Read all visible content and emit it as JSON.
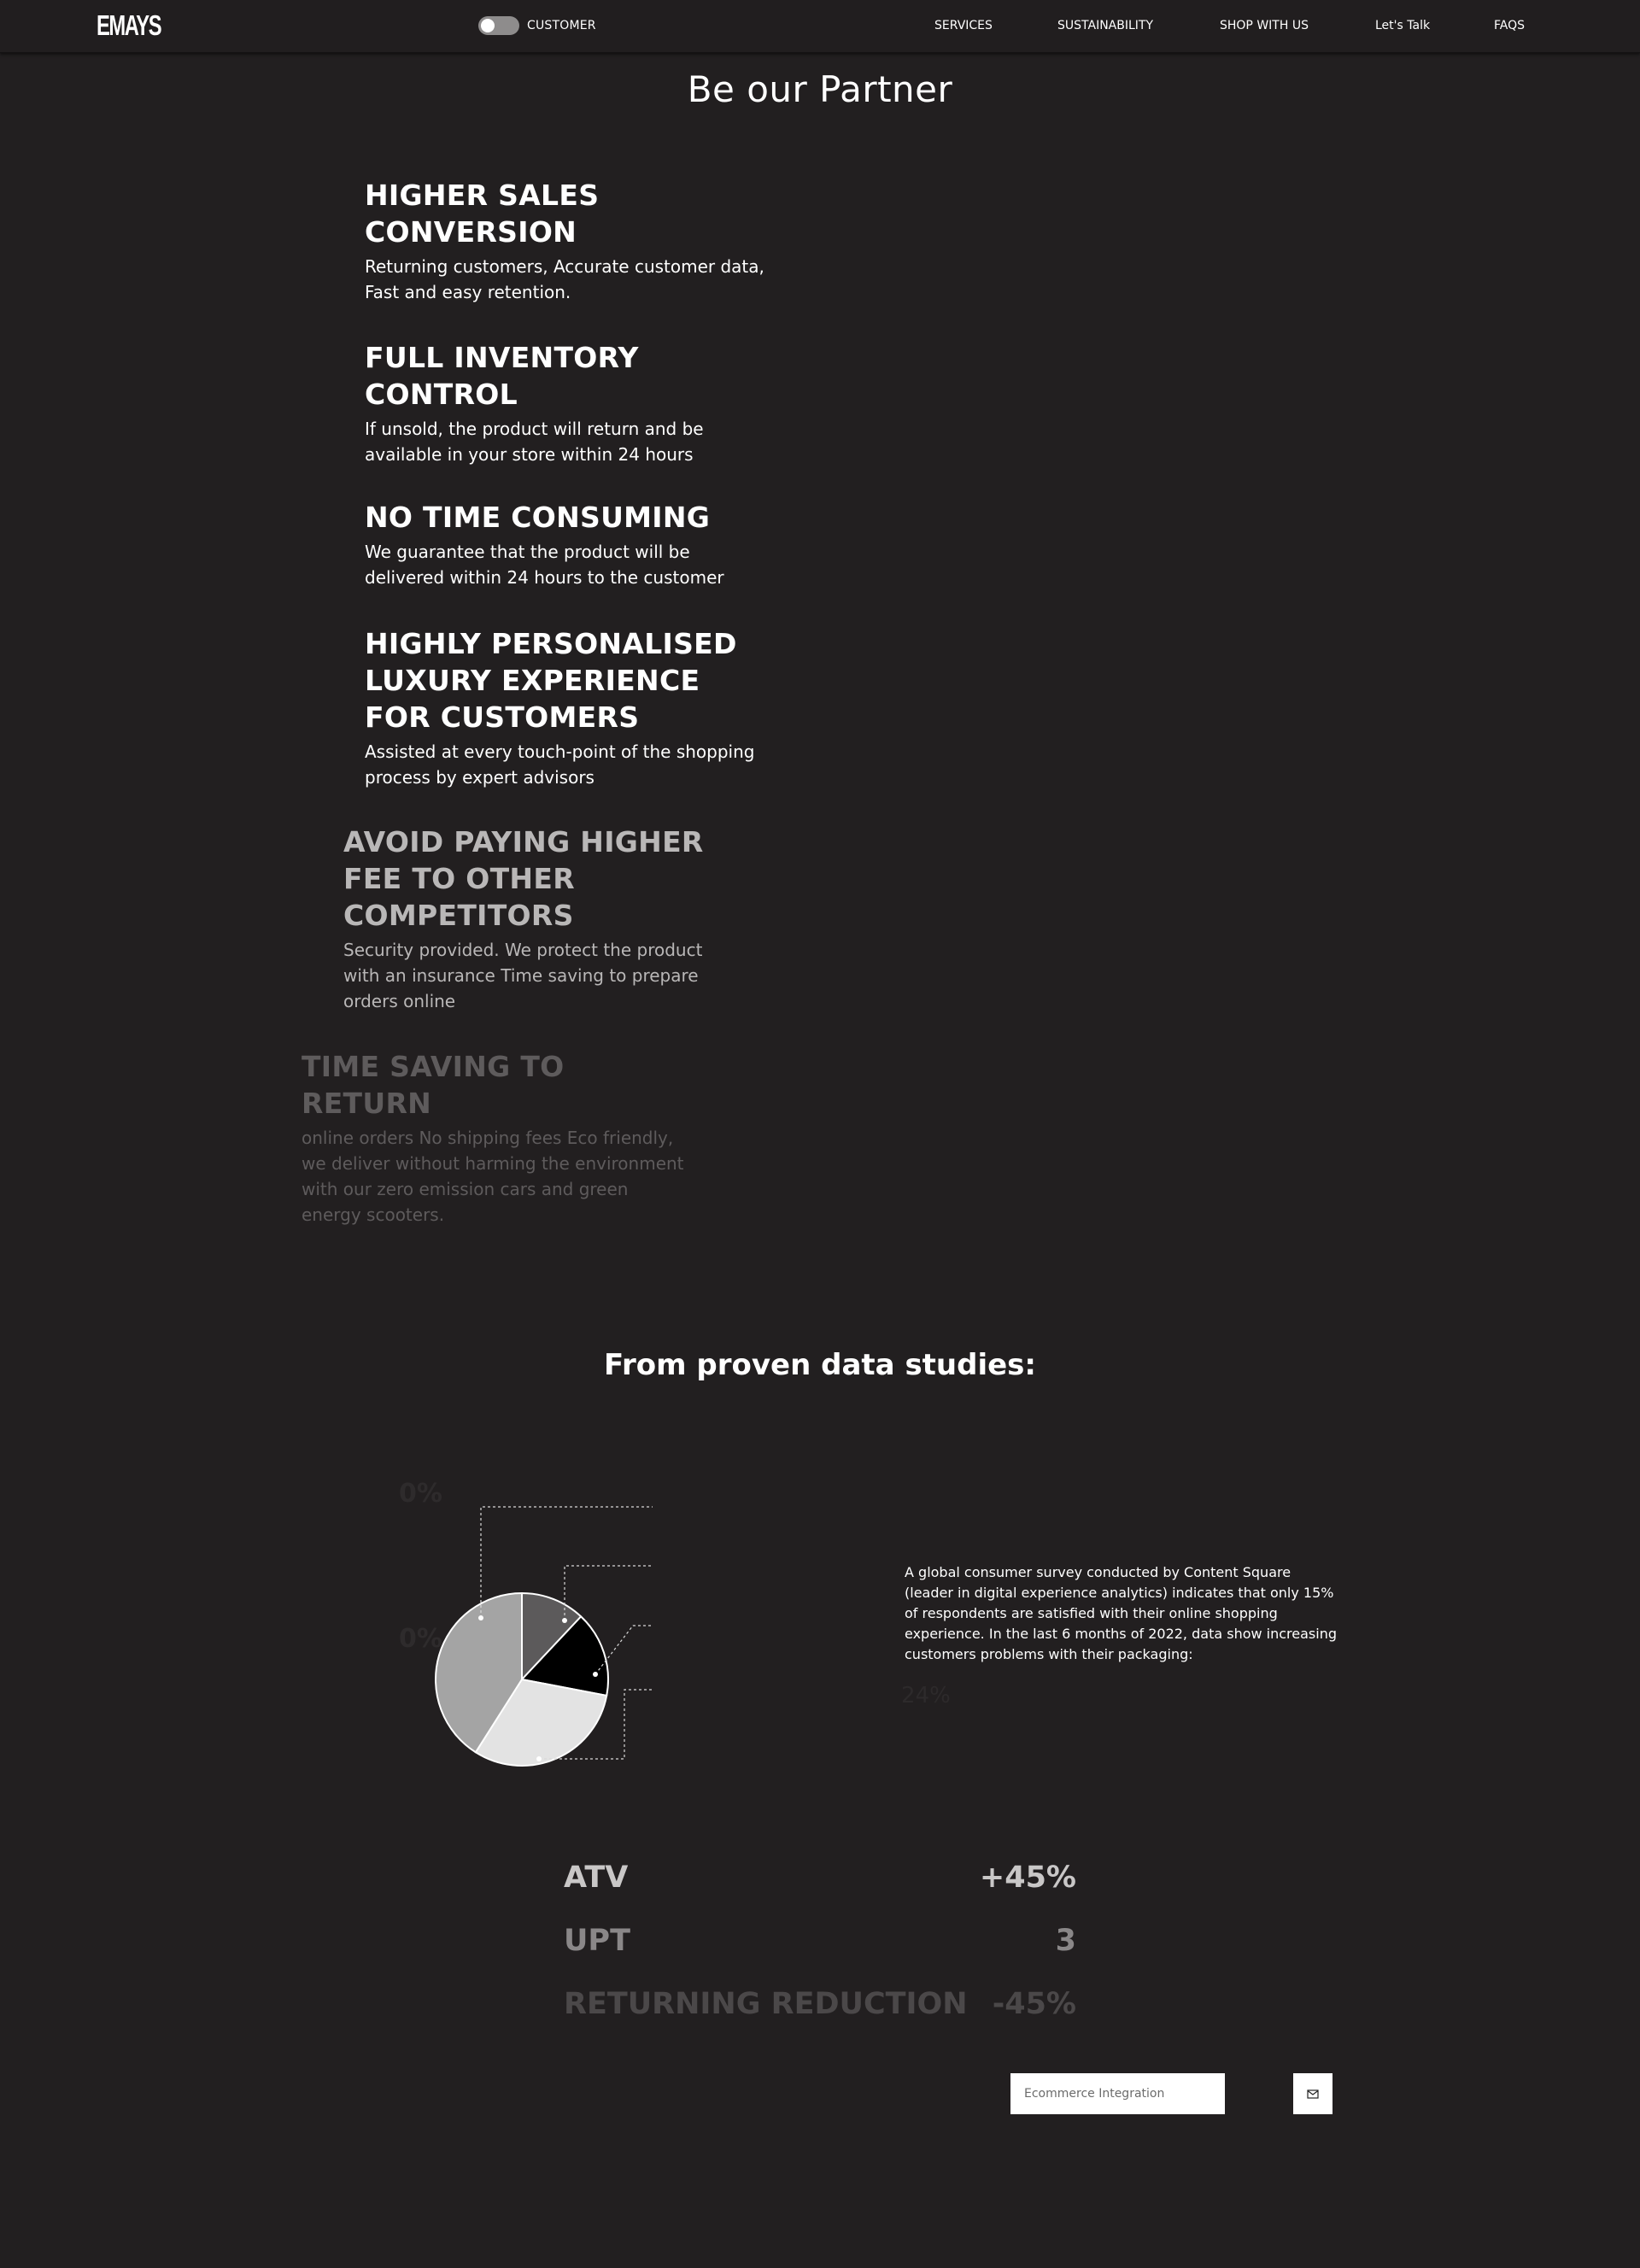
{
  "header": {
    "logo": "EMAYS",
    "toggle_label": "CUSTOMER",
    "nav": [
      "SERVICES",
      "SUSTAINABILITY",
      "SHOP WITH US",
      "Let's Talk",
      "FAQS"
    ]
  },
  "page_title": "Be our Partner",
  "features": [
    {
      "title": "HIGHER SALES CONVERSION",
      "text": "Returning customers, Accurate customer data, Fast and easy retention."
    },
    {
      "title": "FULL INVENTORY CONTROL",
      "text": "If unsold, the product will return and be available in your store within 24 hours"
    },
    {
      "title": "NO TIME CONSUMING",
      "text": "We guarantee that the product will be delivered within 24 hours to the customer"
    },
    {
      "title": "HIGHLY PERSONALISED LUXURY EXPERIENCE FOR CUSTOMERS",
      "text": "Assisted at every touch-point of the shopping process by expert advisors"
    },
    {
      "title": "AVOID PAYING HIGHER FEE TO OTHER COMPETITORS",
      "text": "Security provided. We protect the product with an insurance Time saving to prepare orders online"
    },
    {
      "title": "TIME SAVING TO RETURN",
      "text": "online orders No shipping fees Eco friendly, we deliver without harming the environment with our zero emission cars and green energy scooters."
    }
  ],
  "data_section_title": "From proven data studies:",
  "chart_data": {
    "type": "pie",
    "values": [
      12,
      16,
      31,
      41
    ],
    "colors": [
      "#5c5a5b",
      "#000000",
      "#e3e3e3",
      "#a4a4a4"
    ],
    "faded_labels": [
      "0%",
      "0%"
    ]
  },
  "survey_text": "A global consumer survey conducted by Content Square (leader in digital experience analytics) indicates that only 15% of respondents are satisfied with their online shopping experience. In the last 6 months of 2022, data show increasing customers problems with their packaging:",
  "faded_stat": {
    "value": "24%"
  },
  "stats": [
    {
      "label": "ATV",
      "value": "+45%"
    },
    {
      "label": "UPT",
      "value": "3"
    },
    {
      "label": "RETURNING REDUCTION",
      "value": "-45%"
    }
  ],
  "integration": {
    "placeholder": "Ecommerce Integration"
  }
}
